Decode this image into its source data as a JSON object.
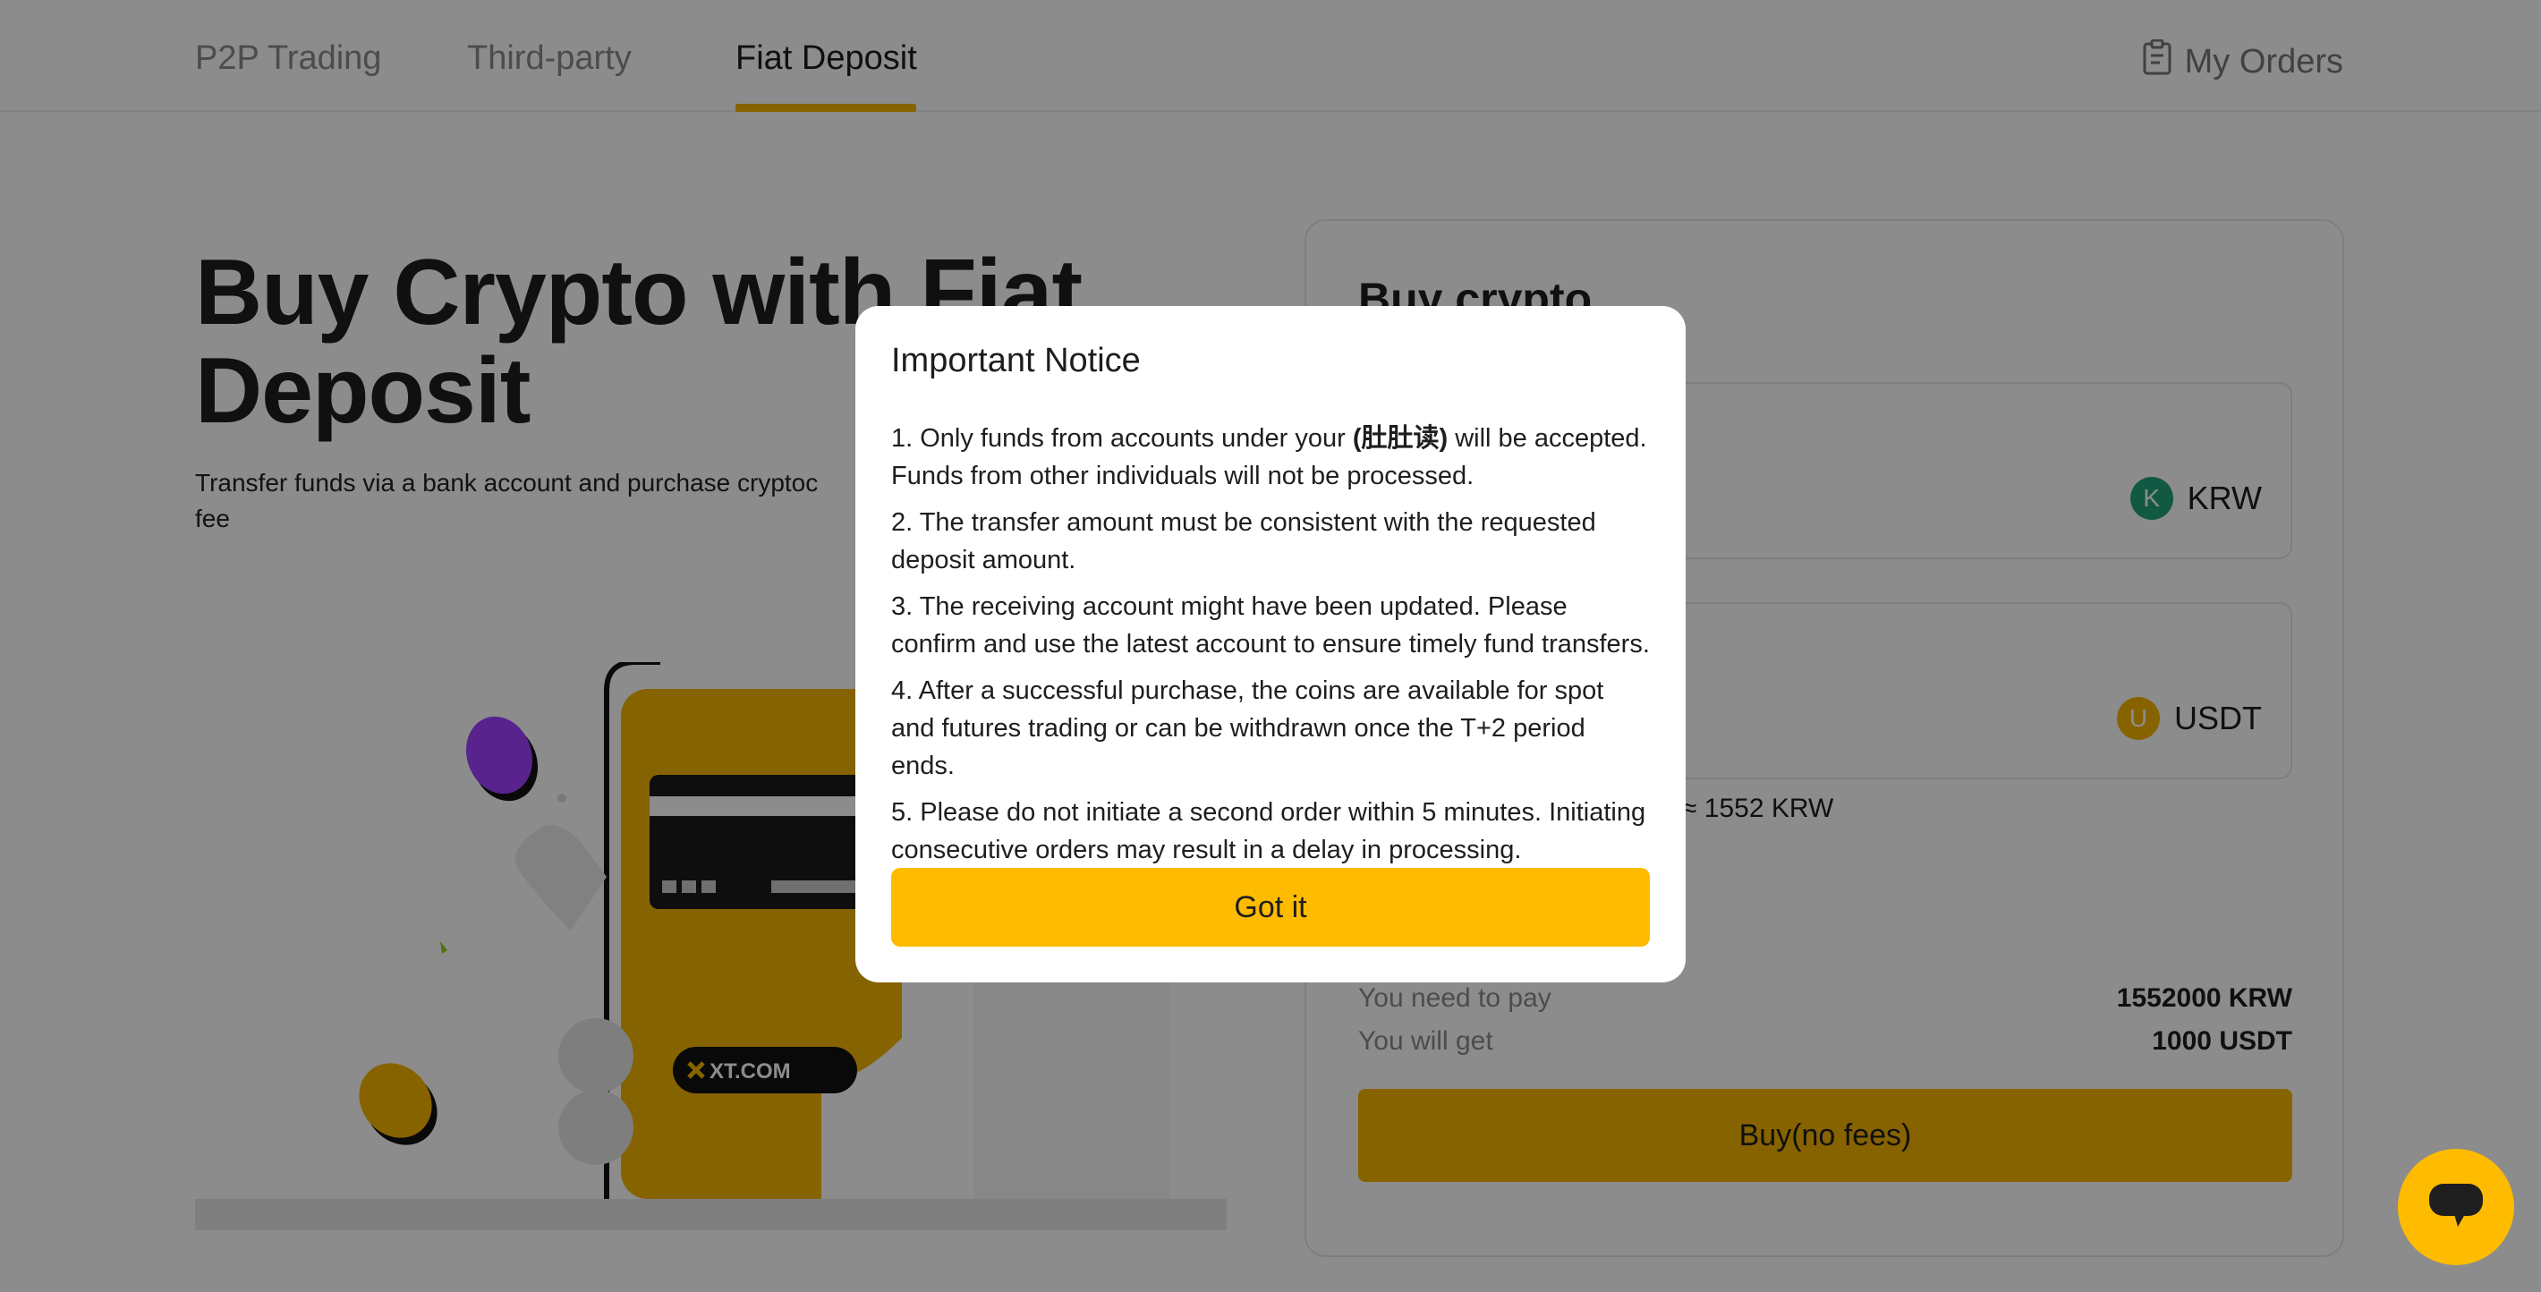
{
  "nav": {
    "tabs": [
      "P2P Trading",
      "Third-party",
      "Fiat Deposit"
    ],
    "active_tab": "Fiat Deposit",
    "my_orders": "My Orders"
  },
  "hero": {
    "title": "Buy Crypto with Fiat Deposit",
    "subtitle": "Transfer funds via a bank account and purchase cryptoc",
    "subtitle_line2": "fee",
    "illustration_brand": "XT.COM"
  },
  "card": {
    "title": "Buy crypto",
    "pay_currency": {
      "letter": "K",
      "code": "KRW",
      "color": "#1fa37b"
    },
    "get_currency": {
      "letter": "U",
      "code": "USDT",
      "color": "#f6b500"
    },
    "rate_text": "≈ 1552 KRW",
    "summary": [
      {
        "label": "You need to pay",
        "value": "1552000 KRW"
      },
      {
        "label": "You will get",
        "value": "1000 USDT"
      }
    ],
    "buy_button": "Buy(no fees)"
  },
  "modal": {
    "title": "Important Notice",
    "items": [
      {
        "before": "1. Only funds from accounts under your ",
        "bold": "(肚肚读)",
        "after": " will be accepted. Funds from other individuals will not be processed."
      },
      {
        "before": "2. The transfer amount must be consistent with the requested deposit amount.",
        "bold": "",
        "after": ""
      },
      {
        "before": "3. The receiving account might have been updated. Please confirm and use the latest account to ensure timely fund transfers.",
        "bold": "",
        "after": ""
      },
      {
        "before": "4. After a successful purchase, the coins are available for spot and futures trading or can be withdrawn once the T+2 period ends.",
        "bold": "",
        "after": ""
      },
      {
        "before": "5. Please do not initiate a second order within 5 minutes. Initiating consecutive orders may result in a delay in processing.",
        "bold": "",
        "after": ""
      }
    ],
    "confirm_button": "Got it"
  },
  "colors": {
    "accent": "#ffbb00",
    "overlay": "rgba(0,0,0,0.45)"
  }
}
